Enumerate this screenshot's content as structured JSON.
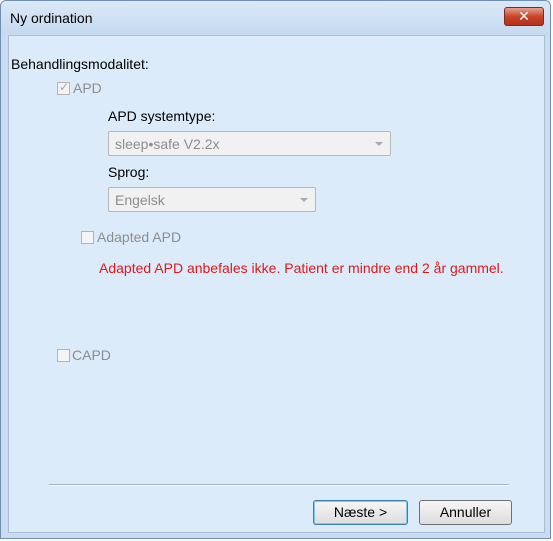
{
  "window": {
    "title": "Ny ordination",
    "close_glyph": "✕"
  },
  "form": {
    "section_label": "Behandlingsmodalitet:",
    "apd": {
      "label": "APD",
      "checked": true
    },
    "system_type": {
      "label": "APD systemtype:",
      "value": "sleep•safe V2.2x"
    },
    "language": {
      "label": "Sprog:",
      "value": "Engelsk"
    },
    "adapted_apd": {
      "label": "Adapted APD",
      "checked": false
    },
    "warning": "Adapted APD anbefales ikke. Patient er mindre end 2 år gammel.",
    "capd": {
      "label": "CAPD",
      "checked": false
    }
  },
  "buttons": {
    "next": "Næste >",
    "cancel": "Annuller"
  },
  "colors": {
    "warning": "#e0191c",
    "client_bg": "#dcebf9"
  }
}
